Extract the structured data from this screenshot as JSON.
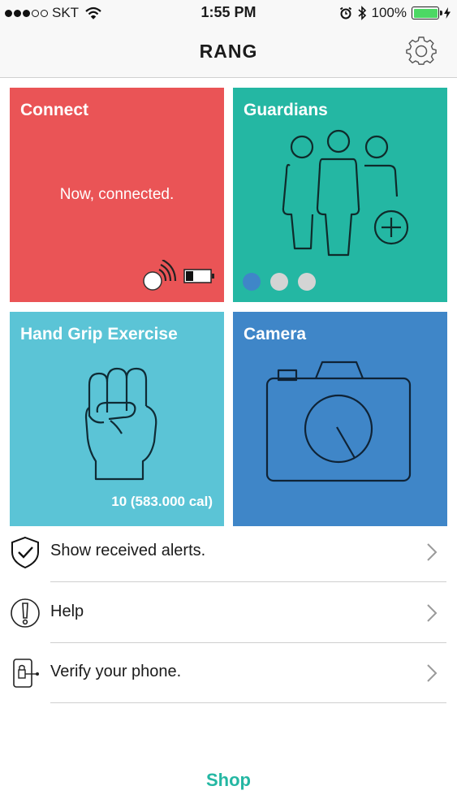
{
  "status_bar": {
    "carrier": "SKT",
    "time": "1:55 PM",
    "battery": "100%",
    "signal_bars_filled": 3,
    "signal_bars_total": 5
  },
  "nav": {
    "title": "RANG",
    "settings_icon": "gear-icon"
  },
  "tiles": {
    "connect": {
      "title": "Connect",
      "status": "Now, connected.",
      "color": "#ea5456",
      "icons": [
        "bluetooth-device-signal-icon",
        "battery-low-icon"
      ]
    },
    "guardians": {
      "title": "Guardians",
      "color": "#24b7a3",
      "icon": "people-add-icon",
      "pager": {
        "count": 3,
        "active_index": 0
      }
    },
    "hand_grip": {
      "title": "Hand Grip Exercise",
      "count": "10 (583.000 cal)",
      "color": "#5bc4d6",
      "icon": "fist-icon"
    },
    "camera": {
      "title": "Camera",
      "color": "#3f86c8",
      "icon": "camera-icon"
    }
  },
  "menu": [
    {
      "label": "Show received alerts.",
      "icon": "shield-check-icon"
    },
    {
      "label": "Help",
      "icon": "exclamation-circle-icon"
    },
    {
      "label": "Verify your phone.",
      "icon": "phone-verify-icon"
    }
  ],
  "footer": {
    "shop_label": "Shop",
    "color": "#24b7a3"
  }
}
